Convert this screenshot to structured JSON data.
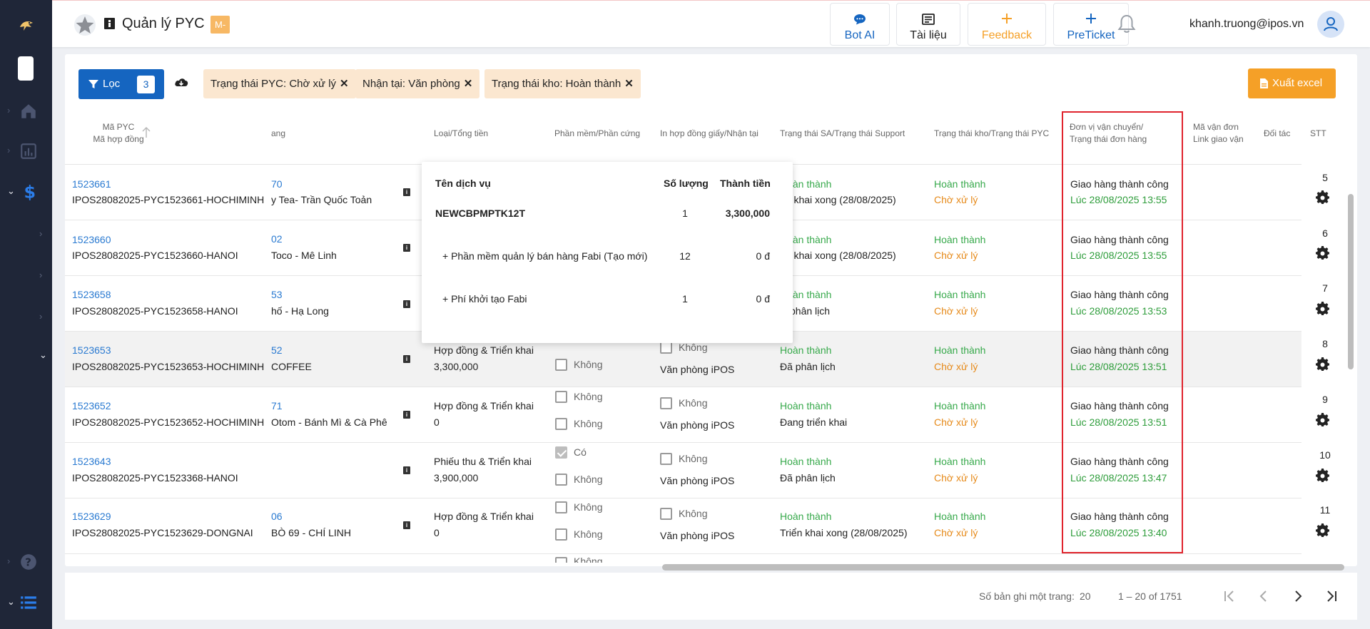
{
  "header": {
    "title": "Quản lý PYC",
    "badge": "M-",
    "buttons": {
      "bot_ai": "Bot AI",
      "docs": "Tài liệu",
      "feedback": "Feedback",
      "preticket": "PreTicket"
    },
    "user_email": "khanh.truong@ipos.vn"
  },
  "toolbar": {
    "filter_label": "Lọc",
    "filter_count": "3",
    "chips": [
      "Trạng thái PYC: Chờ xử lý",
      "Nhận tại: Văn phòng",
      "Trạng thái kho: Hoàn thành"
    ],
    "export_label": "Xuất excel"
  },
  "columns": {
    "ma_pyc": "Mã PYC",
    "ma_hop_dong": "Mã hợp đồng",
    "cua_hang": "ang",
    "loai": "Loại/Tổng tiền",
    "phan_mem": "Phần mềm/Phần cứng",
    "in_hop_dong": "In hợp đồng giấy/Nhận tại",
    "trang_thai_sa": "Trạng thái SA/Trạng thái Support",
    "trang_thai_kho": "Trạng thái kho/Trạng thái PYC",
    "don_vi_1": "Đơn vị vận chuyển/",
    "don_vi_2": "Trạng thái đơn hàng",
    "ma_van_don": "Mã vận đơn",
    "link_giao_van": "Link giao vận",
    "doi_tac": "Đối tác",
    "stt": "STT"
  },
  "rows": [
    {
      "pyc": "1523661",
      "contract": "IPOS28082025-PYC1523661-HOCHIMINH",
      "store_code": "70",
      "store": "y Tea- Trần Quốc Toản",
      "loai": "",
      "tong": "",
      "sw": "",
      "hw": "",
      "print": "",
      "office": "",
      "sa": "Hoàn thành",
      "support": "ển khai xong (28/08/2025)",
      "kho": "Hoàn thành",
      "pyc_status": "Chờ xử lý",
      "ship": "Giao hàng thành công",
      "ship_time": "Lúc 28/08/2025 13:55",
      "stt": "5"
    },
    {
      "pyc": "1523660",
      "contract": "IPOS28082025-PYC1523660-HANOI",
      "store_code": "02",
      "store": "Toco - Mê Linh",
      "loai": "",
      "tong": "",
      "sw": "",
      "hw": "",
      "print": "",
      "office": "",
      "sa": "Hoàn thành",
      "support": "ển khai xong (28/08/2025)",
      "kho": "Hoàn thành",
      "pyc_status": "Chờ xử lý",
      "ship": "Giao hàng thành công",
      "ship_time": "Lúc 28/08/2025 13:55",
      "stt": "6"
    },
    {
      "pyc": "1523658",
      "contract": "IPOS28082025-PYC1523658-HANOI",
      "store_code": "53",
      "store": "hố - Hạ Long",
      "loai": "",
      "tong": "",
      "sw": "",
      "hw": "",
      "print": "",
      "office": "",
      "sa": "Hoàn thành",
      "support": "phân lịch",
      "kho": "Hoàn thành",
      "pyc_status": "Chờ xử lý",
      "ship": "Giao hàng thành công",
      "ship_time": "Lúc 28/08/2025 13:53",
      "stt": "7"
    },
    {
      "pyc": "1523653",
      "contract": "IPOS28082025-PYC1523653-HOCHIMINH",
      "store_code": "52",
      "store": "COFFEE",
      "loai": "Hợp đồng & Triển khai",
      "tong": "3,300,000",
      "sw": "",
      "hw": "Không",
      "print": "Không",
      "office": "Văn phòng iPOS",
      "sa": "Hoàn thành",
      "support": "Đã phân lịch",
      "kho": "Hoàn thành",
      "pyc_status": "Chờ xử lý",
      "ship": "Giao hàng thành công",
      "ship_time": "Lúc 28/08/2025 13:51",
      "stt": "8"
    },
    {
      "pyc": "1523652",
      "contract": "IPOS28082025-PYC1523652-HOCHIMINH",
      "store_code": "71",
      "store": "Otom - Bánh Mì & Cà Phê",
      "loai": "Hợp đồng & Triển khai",
      "tong": "0",
      "sw": "Không",
      "hw": "Không",
      "print": "Không",
      "office": "Văn phòng iPOS",
      "sa": "Hoàn thành",
      "support": "Đang triển khai",
      "kho": "Hoàn thành",
      "pyc_status": "Chờ xử lý",
      "ship": "Giao hàng thành công",
      "ship_time": "Lúc 28/08/2025 13:51",
      "stt": "9"
    },
    {
      "pyc": "1523643",
      "contract": "IPOS28082025-PYC1523368-HANOI",
      "store_code": "",
      "store": "",
      "loai": "Phiếu thu & Triển khai",
      "tong": "3,900,000",
      "sw": "Có",
      "hw": "Không",
      "print": "Không",
      "office": "Văn phòng iPOS",
      "sa": "Hoàn thành",
      "support": "Đã phân lịch",
      "kho": "Hoàn thành",
      "pyc_status": "Chờ xử lý",
      "ship": "Giao hàng thành công",
      "ship_time": "Lúc 28/08/2025 13:47",
      "stt": "10"
    },
    {
      "pyc": "1523629",
      "contract": "IPOS28082025-PYC1523629-DONGNAI",
      "store_code": "06",
      "store": "BÒ 69 - CHÍ LINH",
      "loai": "Hợp đồng & Triển khai",
      "tong": "0",
      "sw": "Không",
      "hw": "Không",
      "print": "Không",
      "office": "Văn phòng iPOS",
      "sa": "Hoàn thành",
      "support": "Triển khai xong (28/08/2025)",
      "kho": "Hoàn thành",
      "pyc_status": "Chờ xử lý",
      "ship": "Giao hàng thành công",
      "ship_time": "Lúc 28/08/2025 13:40",
      "stt": "11"
    }
  ],
  "partial_row": {
    "sw": "Không"
  },
  "popup": {
    "col_service": "Tên dịch vụ",
    "col_qty": "Số lượng",
    "col_amount": "Thành tiền",
    "items": [
      {
        "name": "NEWCBPMPTK12T",
        "qty": "1",
        "amount": "3,300,000"
      },
      {
        "name": "+ Phần mềm quản lý bán hàng Fabi (Tạo mới)",
        "qty": "12",
        "amount": "0 đ"
      },
      {
        "name": "+ Phí khởi tạo Fabi",
        "qty": "1",
        "amount": "0 đ"
      }
    ]
  },
  "pagination": {
    "per_page_label": "Số bản ghi một trang:",
    "per_page": "20",
    "range": "1 – 20 of 1751"
  },
  "colors": {
    "sidebar": "#1f2638",
    "primary": "#1565c0",
    "accent_orange": "#f5a027",
    "chip_bg": "#fbe7d0",
    "status_green": "#37a94b",
    "status_orange": "#e68a1a",
    "highlight_red": "#e0242d"
  },
  "icons": [
    "bird-logo-icon",
    "home-icon",
    "chart-icon",
    "dollar-icon",
    "help-icon",
    "list-icon",
    "star-logo-icon",
    "info-icon",
    "chat-icon",
    "book-icon",
    "plus-icon",
    "bell-icon",
    "user-icon",
    "filter-icon",
    "cloud-download-icon",
    "file-icon",
    "sort-up-icon",
    "gear-icon",
    "first-page-icon",
    "prev-page-icon",
    "next-page-icon",
    "last-page-icon"
  ]
}
